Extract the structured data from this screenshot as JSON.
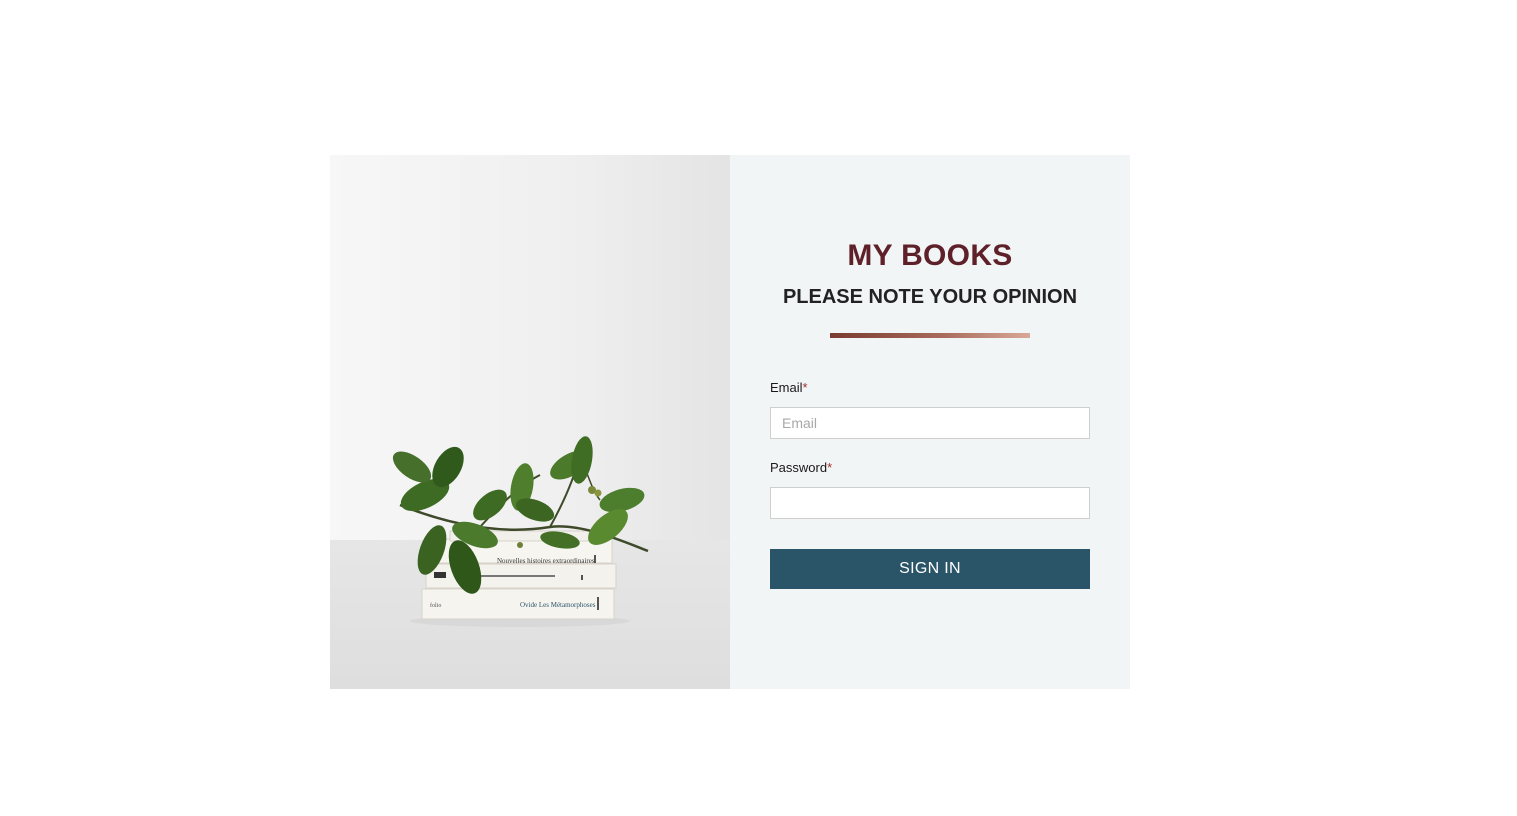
{
  "header": {
    "title": "MY BOOKS",
    "subtitle": "PLEASE NOTE YOUR OPINION"
  },
  "form": {
    "email_label": "Email",
    "email_required_mark": "*",
    "email_placeholder": "Email",
    "email_value": "",
    "password_label": "Password",
    "password_required_mark": "*",
    "password_placeholder": "",
    "password_value": "",
    "submit_label": "SIGN IN"
  },
  "image": {
    "book_titles": [
      "Nouvelles histoires extraordinaires",
      "Ovide  Les Métamorphoses"
    ]
  },
  "colors": {
    "title": "#5e2129",
    "button": "#2a5468",
    "form_background": "#f2f5f6",
    "divider_start": "#7a3a30",
    "divider_end": "#d9a898"
  },
  "icons": {
    "photo": "books-with-plant-photo"
  }
}
